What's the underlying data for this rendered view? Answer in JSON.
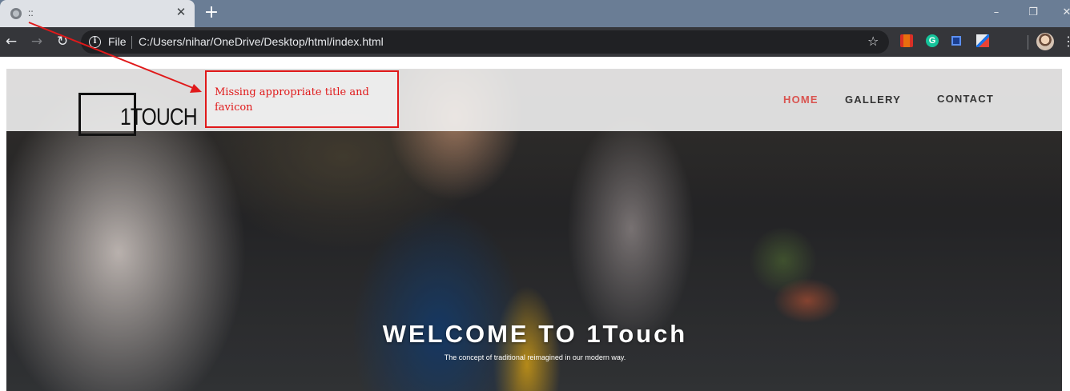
{
  "browser": {
    "tab_title": "::",
    "tab_close_icon": "close-icon",
    "new_tab_icon": "plus-icon",
    "window_controls": {
      "minimize": "–",
      "restore": "❐",
      "close": "✕"
    },
    "nav": {
      "back": "←",
      "forward": "→",
      "reload": "↻"
    },
    "address": {
      "info_icon": "i",
      "scheme": "File",
      "url": "C:/Users/nihar/OneDrive/Desktop/html/index.html",
      "star": "☆"
    },
    "extensions": [
      "red-bookmark-extension",
      "grammarly-extension",
      "blue-square-extension",
      "drawing-extension"
    ],
    "ext2_label": "G"
  },
  "site": {
    "logo_text": "1TOUCH",
    "nav": [
      {
        "label": "HOME",
        "active": true
      },
      {
        "label": "GALLERY",
        "active": false
      },
      {
        "label": "CONTACT",
        "active": false
      }
    ],
    "hero_title": "WELCOME TO 1Touch",
    "hero_subtitle": "The concept of traditional reimagined in our modern way."
  },
  "annotation": {
    "text": "Missing appropriate title and favicon",
    "color": "#e0191a"
  },
  "colors": {
    "accent": "#d9534f",
    "tabstrip": "#6a7d95",
    "toolbar": "#35363a"
  }
}
